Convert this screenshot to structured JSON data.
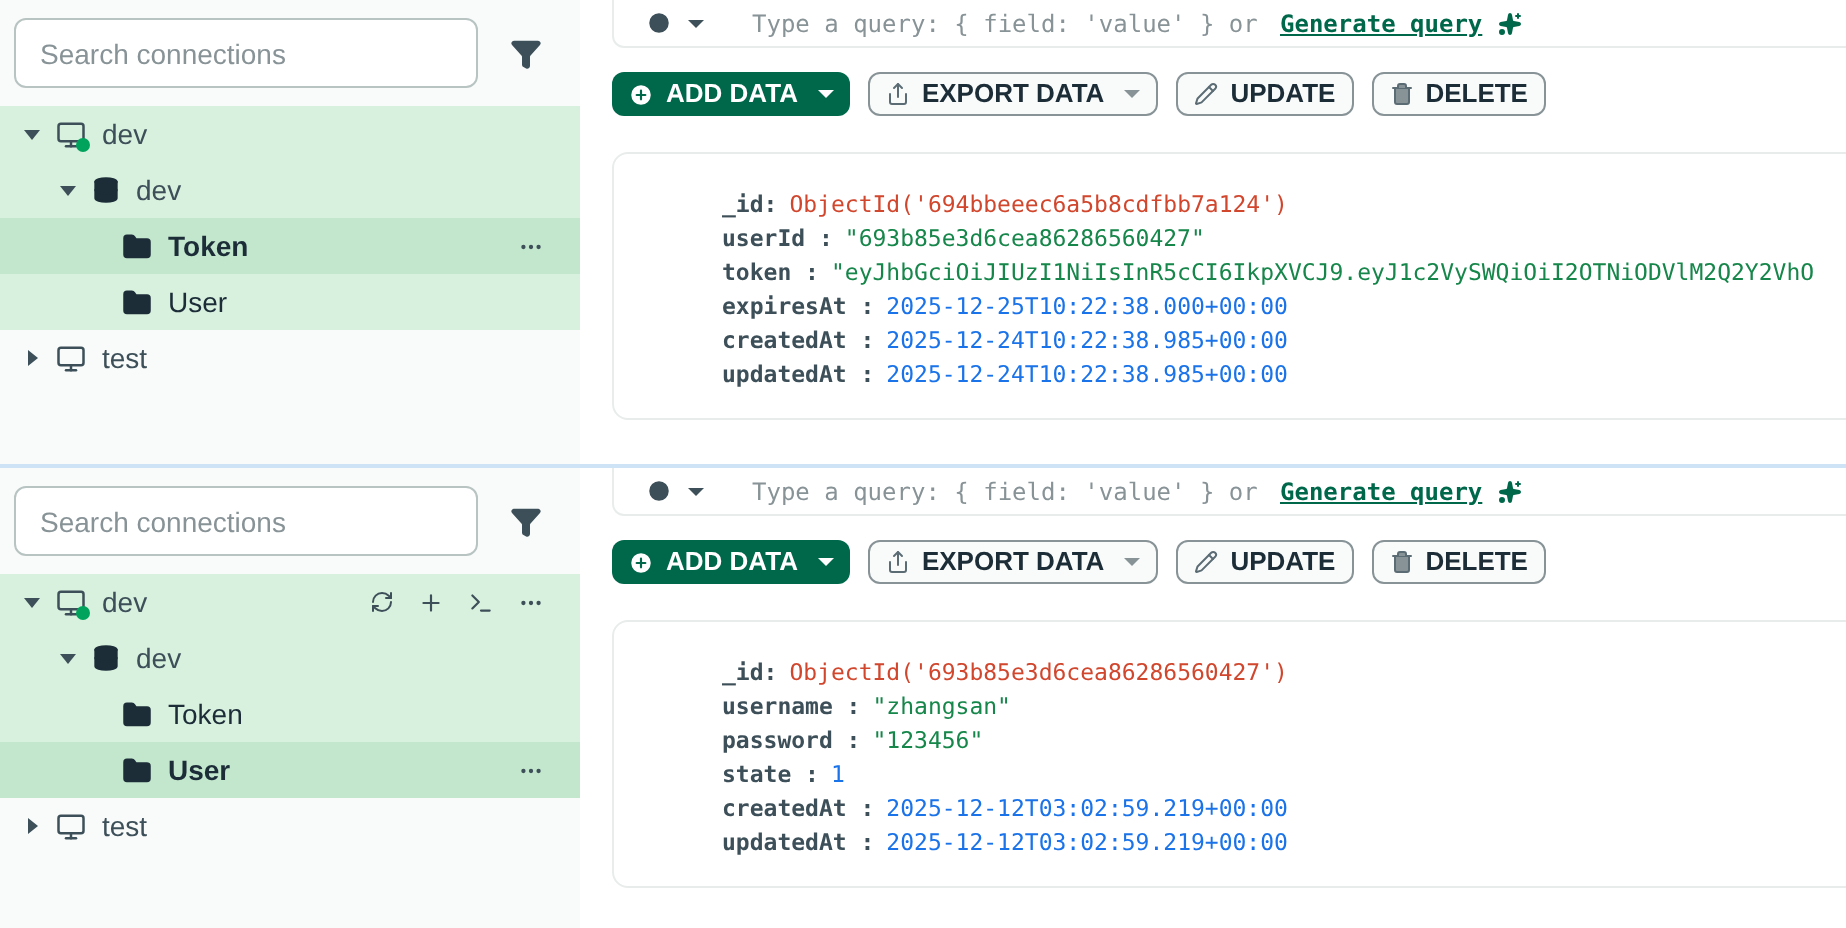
{
  "panels": [
    {
      "sidebar": {
        "search": {
          "placeholder": "Search connections"
        },
        "connections": [
          {
            "name": "dev",
            "expanded": true,
            "connected": true,
            "show_actions": false,
            "children": [
              {
                "name": "dev",
                "expanded": true,
                "children": [
                  {
                    "name": "Token",
                    "selected": true
                  },
                  {
                    "name": "User",
                    "selected": false
                  }
                ]
              }
            ]
          },
          {
            "name": "test",
            "expanded": false,
            "connected": false,
            "show_actions": false
          }
        ]
      },
      "query": {
        "placeholder": "Type a query: { field: 'value' } or",
        "link": "Generate query"
      },
      "buttons": [
        {
          "label": "ADD DATA",
          "kind": "primary"
        },
        {
          "label": "EXPORT DATA",
          "kind": "dropdown"
        },
        {
          "label": "UPDATE",
          "kind": "update"
        },
        {
          "label": "DELETE",
          "kind": "delete"
        }
      ],
      "document": [
        {
          "key": "_id:",
          "value": "ObjectId('694bbeeec6a5b8cdfbb7a124')",
          "kind": "objectid"
        },
        {
          "key": "userId :",
          "value": "\"693b85e3d6cea86286560427\"",
          "kind": "string"
        },
        {
          "key": "token :",
          "value": "\"eyJhbGciOiJIUzI1NiIsInR5cCI6IkpXVCJ9.eyJ1c2VySWQiOiI2OTNiODVlM2Q2Y2VhO",
          "kind": "string"
        },
        {
          "key": "expiresAt :",
          "value": "2025-12-25T10:22:38.000+00:00",
          "kind": "date"
        },
        {
          "key": "createdAt :",
          "value": "2025-12-24T10:22:38.985+00:00",
          "kind": "date"
        },
        {
          "key": "updatedAt :",
          "value": "2025-12-24T10:22:38.985+00:00",
          "kind": "date"
        }
      ]
    },
    {
      "sidebar": {
        "search": {
          "placeholder": "Search connections"
        },
        "connections": [
          {
            "name": "dev",
            "expanded": true,
            "connected": true,
            "show_actions": true,
            "children": [
              {
                "name": "dev",
                "expanded": true,
                "children": [
                  {
                    "name": "Token",
                    "selected": false
                  },
                  {
                    "name": "User",
                    "selected": true
                  }
                ]
              }
            ]
          },
          {
            "name": "test",
            "expanded": false,
            "connected": false,
            "show_actions": false
          }
        ]
      },
      "query": {
        "placeholder": "Type a query: { field: 'value' } or",
        "link": "Generate query"
      },
      "buttons": [
        {
          "label": "ADD DATA",
          "kind": "primary"
        },
        {
          "label": "EXPORT DATA",
          "kind": "dropdown"
        },
        {
          "label": "UPDATE",
          "kind": "update"
        },
        {
          "label": "DELETE",
          "kind": "delete"
        }
      ],
      "document": [
        {
          "key": "_id:",
          "value": "ObjectId('693b85e3d6cea86286560427')",
          "kind": "objectid"
        },
        {
          "key": "username :",
          "value": "\"zhangsan\"",
          "kind": "string"
        },
        {
          "key": "password :",
          "value": "\"123456\"",
          "kind": "string"
        },
        {
          "key": "state :",
          "value": "1",
          "kind": "number"
        },
        {
          "key": "createdAt :",
          "value": "2025-12-12T03:02:59.219+00:00",
          "kind": "date"
        },
        {
          "key": "updatedAt :",
          "value": "2025-12-12T03:02:59.219+00:00",
          "kind": "date"
        }
      ]
    }
  ]
}
